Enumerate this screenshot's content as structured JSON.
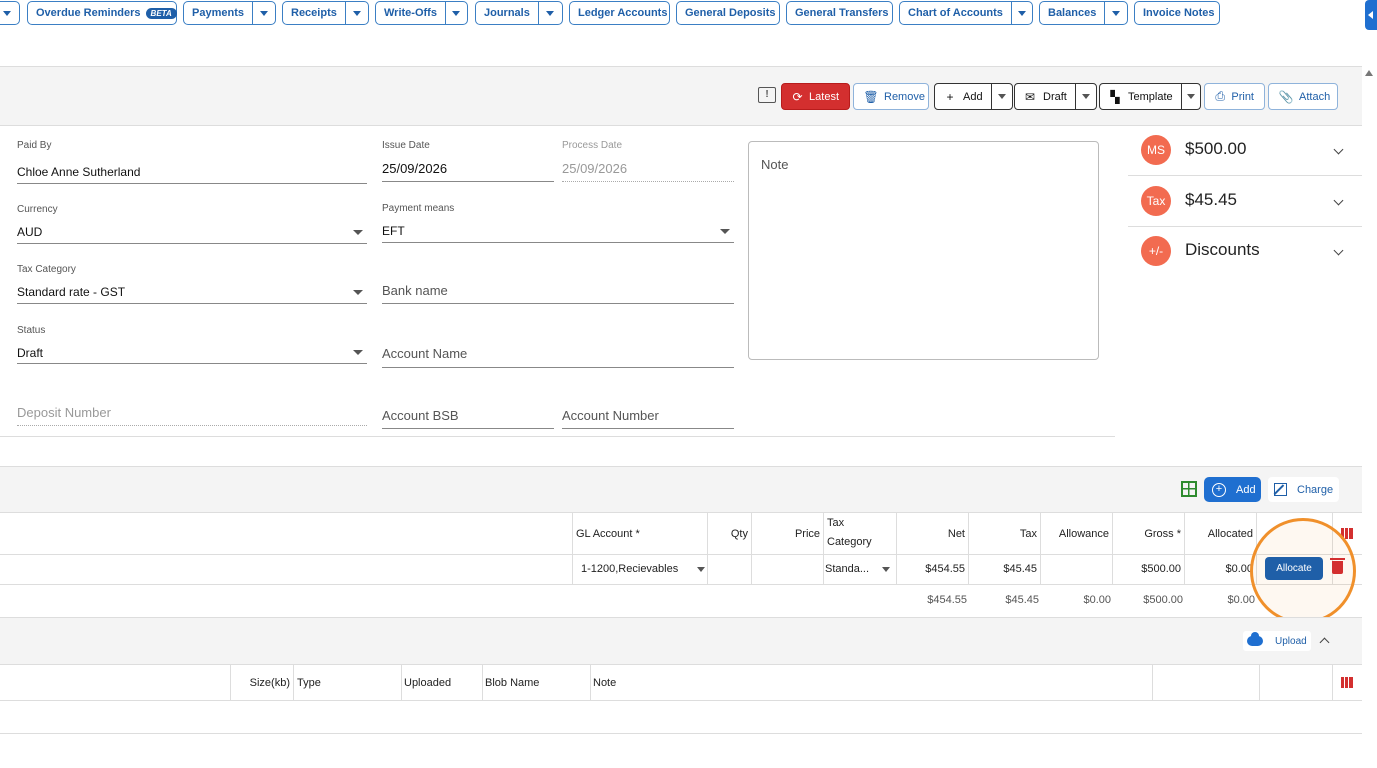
{
  "nav": {
    "items": [
      {
        "label": "Overdue Reminders",
        "badge": "BETA",
        "dropdown": false
      },
      {
        "label": "Payments",
        "dropdown": true
      },
      {
        "label": "Receipts",
        "dropdown": true
      },
      {
        "label": "Write-Offs",
        "dropdown": true
      },
      {
        "label": "Journals",
        "dropdown": true
      },
      {
        "label": "Ledger Accounts",
        "dropdown": false
      },
      {
        "label": "General Deposits",
        "dropdown": false
      },
      {
        "label": "General Transfers",
        "dropdown": false
      },
      {
        "label": "Chart of Accounts",
        "dropdown": true
      },
      {
        "label": "Balances",
        "dropdown": true
      },
      {
        "label": "Invoice Notes",
        "dropdown": false
      }
    ]
  },
  "toolbar": {
    "latest": "Latest",
    "remove": "Remove",
    "add": "Add",
    "draft": "Draft",
    "template": "Template",
    "print": "Print",
    "attach": "Attach"
  },
  "form": {
    "paid_by": {
      "label": "Paid By",
      "value": "Chloe Anne Sutherland"
    },
    "issue_date": {
      "label": "Issue Date",
      "value": "25/09/2026"
    },
    "process_date": {
      "label": "Process Date",
      "value": "25/09/2026"
    },
    "currency": {
      "label": "Currency",
      "value": "AUD"
    },
    "payment_means": {
      "label": "Payment means",
      "value": "EFT"
    },
    "tax_category": {
      "label": "Tax Category",
      "value": "Standard rate - GST"
    },
    "bank_name": {
      "placeholder": "Bank name"
    },
    "status": {
      "label": "Status",
      "value": "Draft"
    },
    "account_name": {
      "placeholder": "Account Name"
    },
    "deposit_number": {
      "placeholder": "Deposit Number"
    },
    "account_bsb": {
      "placeholder": "Account BSB"
    },
    "account_number": {
      "placeholder": "Account Number"
    },
    "note": {
      "placeholder": "Note"
    }
  },
  "summary": [
    {
      "badge": "MS",
      "value": "$500.00"
    },
    {
      "badge": "Tax",
      "value": "$45.45"
    },
    {
      "badge": "+/-",
      "value": "Discounts"
    }
  ],
  "lines": {
    "add_label": "Add",
    "charge_label": "Charge",
    "headers": {
      "gl_account": "GL Account *",
      "qty": "Qty",
      "price": "Price",
      "tax_category_1": "Tax",
      "tax_category_2": "Category",
      "net": "Net",
      "tax": "Tax",
      "allowance": "Allowance",
      "gross": "Gross *",
      "allocated": "Allocated"
    },
    "row": {
      "gl_account": "1-1200,Recievables",
      "qty": "",
      "price": "",
      "tax_category": "Standa...",
      "net": "$454.55",
      "tax": "$45.45",
      "allowance": "",
      "gross": "$500.00",
      "allocated": "$0.00",
      "allocate_label": "Allocate"
    },
    "totals": {
      "net": "$454.55",
      "tax": "$45.45",
      "allowance": "$0.00",
      "gross": "$500.00",
      "allocated": "$0.00"
    }
  },
  "attachments": {
    "upload_label": "Upload",
    "headers": {
      "size": "Size(kb)",
      "type": "Type",
      "uploaded": "Uploaded",
      "blob_name": "Blob Name",
      "note": "Note"
    }
  },
  "colors": {
    "accent": "#1f6fd0",
    "danger": "#d32f2f",
    "badge": "#f26b50",
    "highlight": "#f0902b"
  }
}
